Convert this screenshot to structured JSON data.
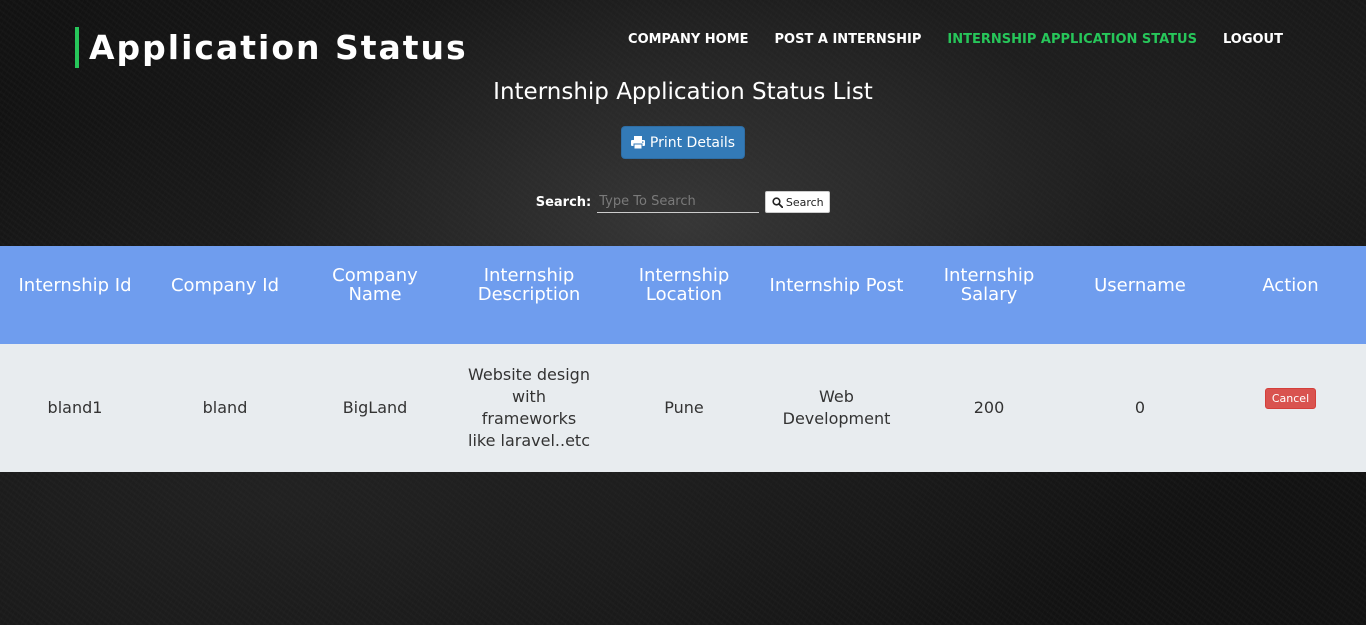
{
  "header": {
    "brand_title": "Application Status",
    "nav": [
      {
        "label": "COMPANY HOME",
        "active": false
      },
      {
        "label": "POST A INTERNSHIP",
        "active": false
      },
      {
        "label": "INTERNSHIP APPLICATION STATUS",
        "active": true
      },
      {
        "label": "LOGOUT",
        "active": false
      }
    ]
  },
  "main": {
    "heading": "Internship Application Status List",
    "print_button": {
      "label": "Print Details",
      "icon": "print-icon"
    },
    "search": {
      "label": "Search:",
      "placeholder": "Type To Search",
      "value": "",
      "button_label": "Search",
      "button_icon": "search-icon"
    }
  },
  "table": {
    "columns": [
      "Internship Id",
      "Company Id",
      "Company Name",
      "Internship Description",
      "Internship Location",
      "Internship Post",
      "Internship Salary",
      "Username",
      "Action"
    ],
    "rows": [
      {
        "internship_id": "bland1",
        "company_id": "bland",
        "company_name": "BigLand",
        "description": "Website design with frameworks like laravel..etc",
        "location": "Pune",
        "post": "Web Development",
        "salary": "200",
        "username": "0",
        "action_label": "Cancel"
      }
    ]
  },
  "colors": {
    "accent_green": "#27c65a",
    "table_header_bg": "#6f9dee",
    "table_row_bg": "#e8ecef",
    "primary_button": "#337ab7",
    "danger_button": "#d9534f"
  }
}
